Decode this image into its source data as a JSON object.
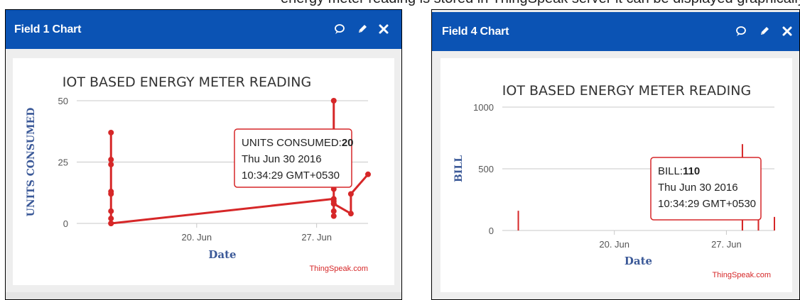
{
  "page_fragment_text": "energy meter reading is stored in ThingSpeak server it can be displayed graphically in the proper way",
  "icons": {
    "comment": "comment-icon",
    "edit": "pencil-icon",
    "close": "close-icon"
  },
  "colors": {
    "header": "#0b53b4",
    "series": "#d62728",
    "axis_label": "#3b5998",
    "credit": "#d62728"
  },
  "panels": [
    {
      "title": "Field 1 Chart",
      "tooltip": {
        "label": "UNITS CONSUMED:",
        "value": "20",
        "line1": "Thu Jun 30 2016",
        "line2": "10:34:29 GMT+0530"
      },
      "credit": "ThingSpeak.com"
    },
    {
      "title": "Field 4 Chart",
      "tooltip": {
        "label": "BILL:",
        "value": "110",
        "line1": "Thu Jun 30 2016",
        "line2": "10:34:29 GMT+0530"
      },
      "credit": "ThingSpeak.com"
    }
  ],
  "chart_data": [
    {
      "type": "line",
      "title": "IOT BASED ENERGY METER READING",
      "xlabel": "Date",
      "ylabel": "UNITS CONSUMED",
      "x_ticks": [
        "20. Jun",
        "27. Jun"
      ],
      "y_ticks": [
        "0",
        "25",
        "50"
      ],
      "ylim": [
        0,
        50
      ],
      "xlim": [
        "2016-06-13",
        "2016-06-30"
      ],
      "grid": true,
      "series": [
        {
          "name": "UNITS CONSUMED",
          "x": [
            "2016-06-15",
            "2016-06-15",
            "2016-06-15",
            "2016-06-15",
            "2016-06-15",
            "2016-06-15",
            "2016-06-15",
            "2016-06-15",
            "2016-06-15",
            "2016-06-28",
            "2016-06-28",
            "2016-06-28",
            "2016-06-28",
            "2016-06-28",
            "2016-06-28",
            "2016-06-28",
            "2016-06-28",
            "2016-06-29",
            "2016-06-29",
            "2016-06-30"
          ],
          "y": [
            0,
            2,
            5,
            12,
            13,
            24,
            26,
            37,
            0,
            10,
            50,
            3,
            8,
            14,
            9,
            5,
            8,
            4,
            12,
            20
          ]
        }
      ]
    },
    {
      "type": "bar",
      "title": "IOT BASED ENERGY METER READING",
      "xlabel": "Date",
      "ylabel": "BILL",
      "x_ticks": [
        "20. Jun",
        "27. Jun"
      ],
      "y_ticks": [
        "0",
        "500",
        "1000"
      ],
      "ylim": [
        0,
        1000
      ],
      "xlim": [
        "2016-06-13",
        "2016-06-30"
      ],
      "grid": true,
      "series": [
        {
          "name": "BILL",
          "x": [
            "2016-06-14",
            "2016-06-28",
            "2016-06-28",
            "2016-06-29",
            "2016-06-29",
            "2016-06-30"
          ],
          "y": [
            160,
            700,
            110,
            130,
            110,
            110
          ]
        }
      ]
    }
  ]
}
